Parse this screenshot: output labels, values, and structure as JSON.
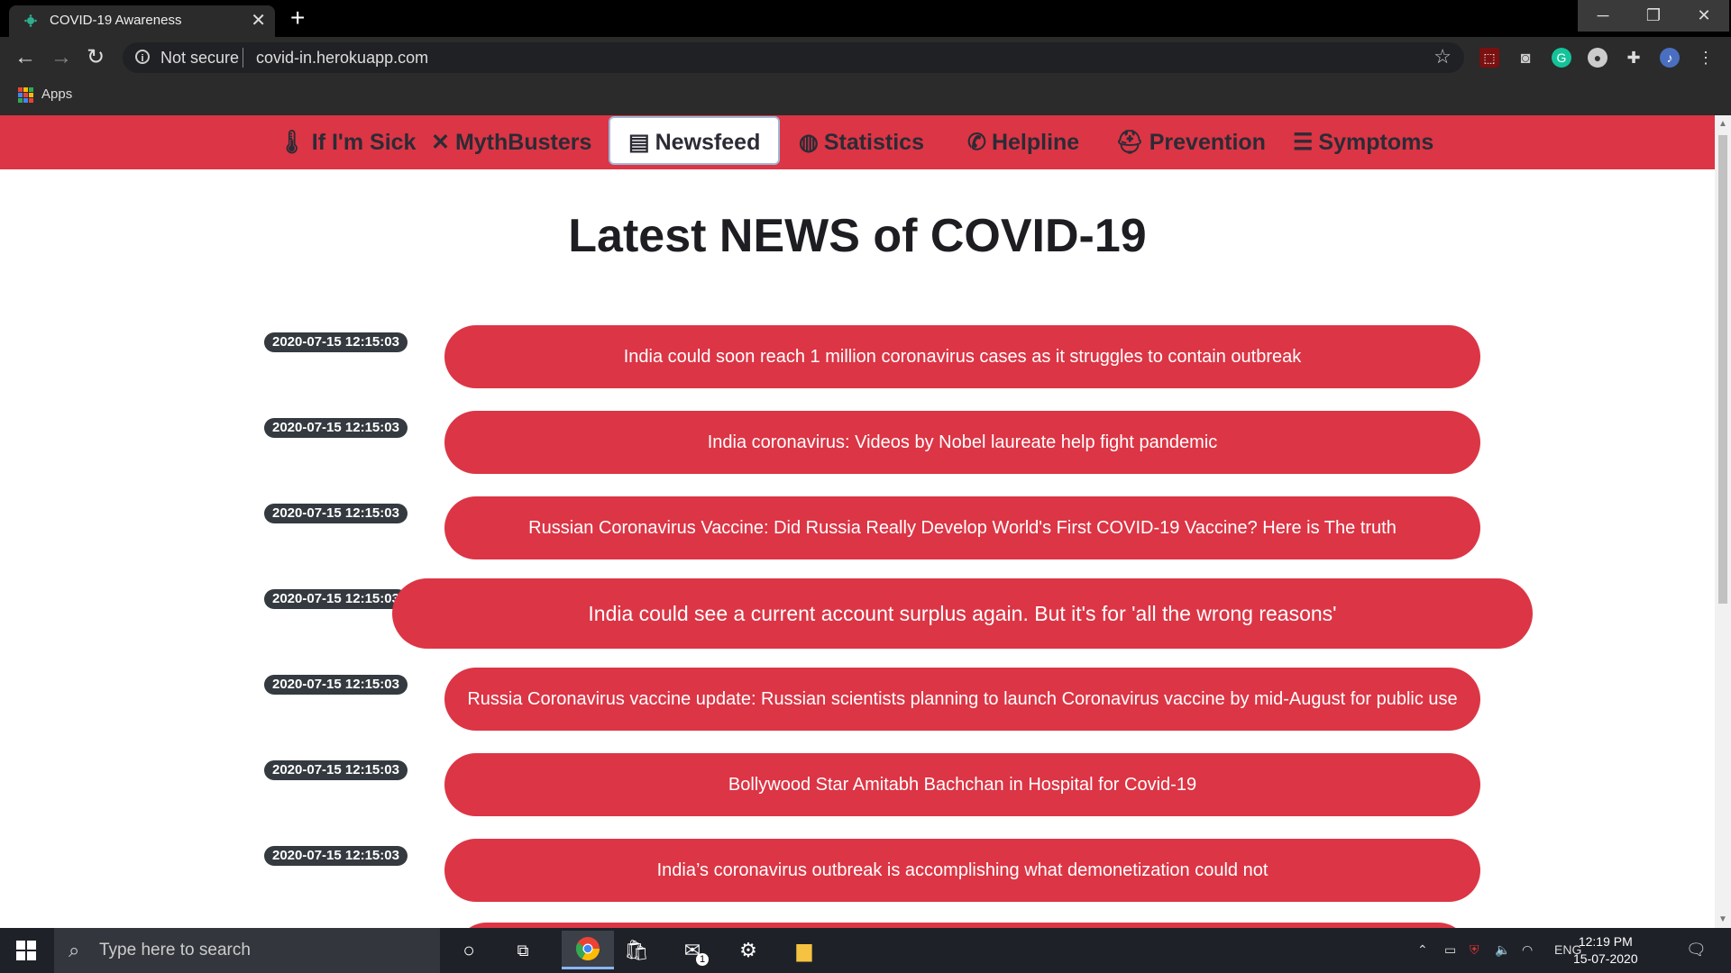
{
  "browser": {
    "tab_title": "COVID-19 Awareness",
    "tab_close": "✕",
    "new_tab": "+",
    "security_label": "Not secure",
    "url": "covid-in.herokuapp.com",
    "bookmarks_apps": "Apps",
    "min": "─",
    "max": "❐",
    "close": "✕"
  },
  "nav": {
    "items": [
      {
        "icon": "🌡",
        "label": "If I'm Sick"
      },
      {
        "icon": "✕",
        "label": "MythBusters"
      },
      {
        "icon": "▤",
        "label": "Newsfeed"
      },
      {
        "icon": "◍",
        "label": "Statistics"
      },
      {
        "icon": "✆",
        "label": "Helpline"
      },
      {
        "icon": "⛑",
        "label": "Prevention"
      },
      {
        "icon": "☰",
        "label": "Symptoms"
      }
    ],
    "active": "Newsfeed",
    "bg_color": "#dc3545"
  },
  "page": {
    "heading": "Latest NEWS of COVID-19"
  },
  "news": [
    {
      "time": "2020-07-15 12:15:03",
      "title": "India could soon reach 1 million coronavirus cases as it struggles to contain outbreak"
    },
    {
      "time": "2020-07-15 12:15:03",
      "title": "India coronavirus: Videos by Nobel laureate help fight pandemic"
    },
    {
      "time": "2020-07-15 12:15:03",
      "title": "Russian Coronavirus Vaccine: Did Russia Really Develop World's First COVID-19 Vaccine? Here is The truth"
    },
    {
      "time": "2020-07-15 12:15:03",
      "title": "India could see a current account surplus again. But it's for 'all the wrong reasons'"
    },
    {
      "time": "2020-07-15 12:15:03",
      "title": "Russia Coronavirus vaccine update: Russian scientists planning to launch Coronavirus vaccine by mid-August for public use"
    },
    {
      "time": "2020-07-15 12:15:03",
      "title": "Bollywood Star Amitabh Bachchan in Hospital for Covid-19"
    },
    {
      "time": "2020-07-15 12:15:03",
      "title": "India’s coronavirus outbreak is accomplishing what demonetization could not"
    }
  ],
  "taskbar": {
    "search_placeholder": "Type here to search",
    "language": "ENG",
    "time": "12:19 PM",
    "date": "15-07-2020",
    "mail_badge": "1"
  }
}
